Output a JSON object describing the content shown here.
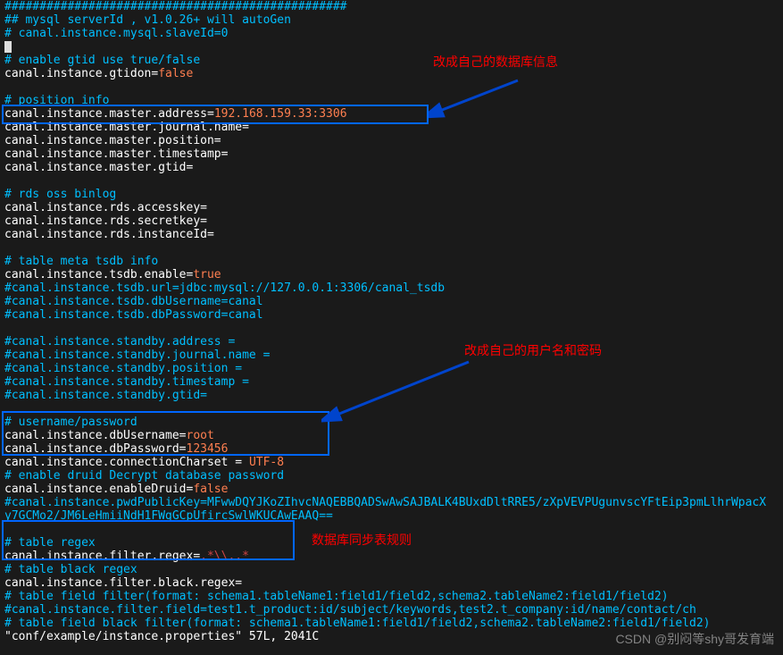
{
  "lines": {
    "l0": "#################################################",
    "l1_a": "## mysql serverId , v1.0.26+ will autoGen",
    "l2": "# canal.instance.mysql.slaveId=0",
    "l4": "# enable gtid use true/false",
    "l5_k": "canal.instance.gtidon=",
    "l5_v": "false",
    "l7": "# position info",
    "l8_k": "canal.instance.master.address=",
    "l8_v": "192.168.159.33:3306",
    "l9": "canal.instance.master.journal.name=",
    "l10": "canal.instance.master.position=",
    "l11": "canal.instance.master.timestamp=",
    "l12": "canal.instance.master.gtid=",
    "l14": "# rds oss binlog",
    "l15": "canal.instance.rds.accesskey=",
    "l16": "canal.instance.rds.secretkey=",
    "l17": "canal.instance.rds.instanceId=",
    "l19": "# table meta tsdb info",
    "l20_k": "canal.instance.tsdb.enable=",
    "l20_v": "true",
    "l21": "#canal.instance.tsdb.url=jdbc:mysql://127.0.0.1:3306/canal_tsdb",
    "l22": "#canal.instance.tsdb.dbUsername=canal",
    "l23": "#canal.instance.tsdb.dbPassword=canal",
    "l25": "#canal.instance.standby.address =",
    "l26": "#canal.instance.standby.journal.name =",
    "l27": "#canal.instance.standby.position =",
    "l28": "#canal.instance.standby.timestamp =",
    "l29": "#canal.instance.standby.gtid=",
    "l31": "# username/password",
    "l32_k": "canal.instance.dbUsername=",
    "l32_v": "root",
    "l33_k": "canal.instance.dbPassword=",
    "l33_v": "123456",
    "l34_k": "canal.instance.connectionCharset = ",
    "l34_v": "UTF-8",
    "l35": "# enable druid Decrypt database password",
    "l36_k": "canal.instance.enableDruid=",
    "l36_v": "false",
    "l37": "#canal.instance.pwdPublicKey=MFwwDQYJKoZIhvcNAQEBBQADSwAwSAJBALK4BUxdDltRRE5/zXpVEVPUgunvscYFtEip3pmLlhrWpacX",
    "l38": "y7GCMo2/JM6LeHmiiNdH1FWgGCpUfircSwlWKUCAwEAAQ==",
    "l40": "# table regex",
    "l41_k": "canal.instance.filter.regex=",
    "l41_v": ".*\\\\..*",
    "l42": "# table black regex",
    "l43": "canal.instance.filter.black.regex=",
    "l44": "# table field filter(format: schema1.tableName1:field1/field2,schema2.tableName2:field1/field2)",
    "l45": "#canal.instance.filter.field=test1.t_product:id/subject/keywords,test2.t_company:id/name/contact/ch",
    "l46": "# table field black filter(format: schema1.tableName1:field1/field2,schema2.tableName2:field1/field2)",
    "l47": "\"conf/example/instance.properties\" 57L, 2041C"
  },
  "annotations": {
    "a1": "改成自己的数据库信息",
    "a2": "改成自己的用户名和密码",
    "a3": "数据库同步表规则"
  },
  "watermark": "CSDN @别闷等shy哥发育端"
}
